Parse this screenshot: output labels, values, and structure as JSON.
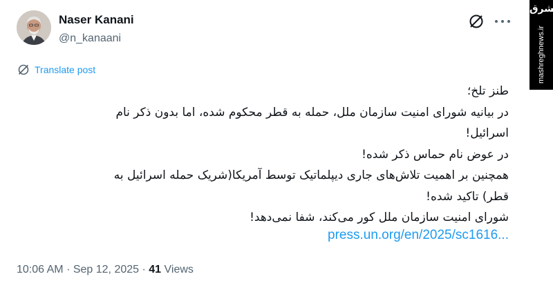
{
  "author": {
    "display_name": "Naser Kanani",
    "handle": "@n_kanaani"
  },
  "actions": {
    "translate_label": "Translate post"
  },
  "tweet": {
    "lines": [
      "طنز تلخ؛",
      "در بیانیه شورای امنیت سازمان ملل، حمله به قطر محکوم شده، اما بدون ذکر نام",
      "اسرائیل!",
      "در عوض نام حماس ذکر شده!",
      "همچنین بر اهمیت تلاش‌های جاری دیپلماتیک توسط آمریکا(شریک حمله اسرائیل به",
      "قطر) تاکید شده!",
      "شورای امنیت سازمان ملل کور می‌کند، شفا نمی‌دهد!"
    ],
    "link": "press.un.org/en/2025/sc1616..."
  },
  "meta": {
    "time": "10:06 AM",
    "separator": "·",
    "date": "Sep 12, 2025",
    "views_count": "41",
    "views_label": "Views"
  },
  "watermark": {
    "logo": "مشرق",
    "url": "mashreghnews.ir"
  },
  "icons": {
    "grok": "grok-icon",
    "more": "more-dots-icon",
    "translate": "translate-icon"
  },
  "colors": {
    "link_blue": "#1d9bf0",
    "text": "#0f1419",
    "muted": "#536471",
    "watermark_bg": "#000000"
  }
}
